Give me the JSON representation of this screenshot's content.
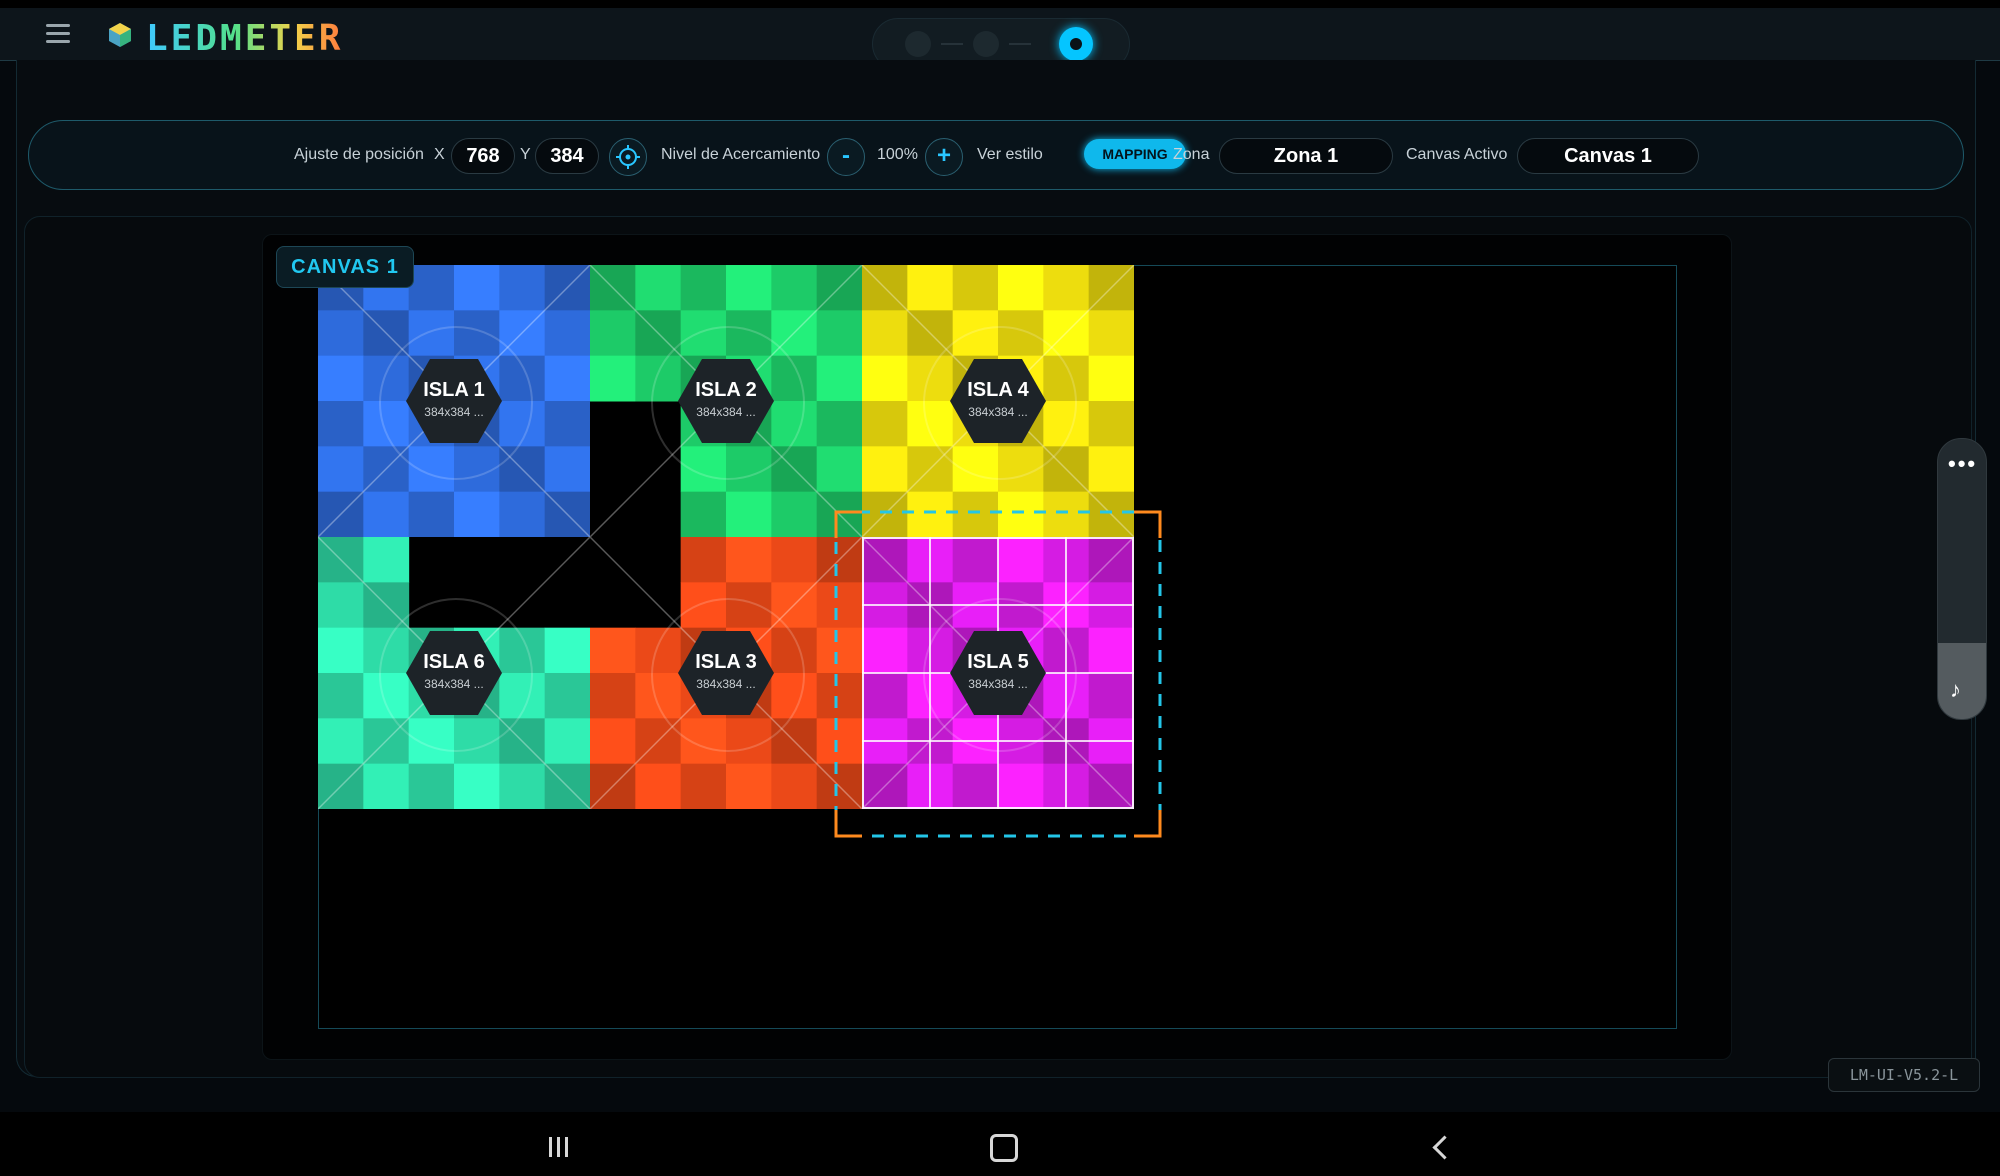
{
  "app": {
    "logo_text": "LEDMETER",
    "version": "LM-UI-V5.2-L"
  },
  "toolbar": {
    "position_label": "Ajuste de posición",
    "x_label": "X",
    "x_value": "768",
    "y_label": "Y",
    "y_value": "384",
    "zoom_label": "Nivel de Acercamiento",
    "zoom_minus": "-",
    "zoom_value": "100%",
    "zoom_plus": "+",
    "style_label": "Ver estilo",
    "style_value": "MAPPING",
    "zone_label": "Zona",
    "zone_value": "Zona 1",
    "canvas_label": "Canvas Activo",
    "canvas_value": "Canvas 1"
  },
  "canvas": {
    "label": "CANVAS 1",
    "islands": [
      {
        "name": "ISLA 1",
        "size": "384x384 ...",
        "color": "#2f6de0"
      },
      {
        "name": "ISLA 2",
        "size": "384x384 ...",
        "color": "#1ecf6a"
      },
      {
        "name": "ISLA 4",
        "size": "384x384 ...",
        "color": "#f2e10e"
      },
      {
        "name": "ISLA 6",
        "size": "384x384 ...",
        "color": "#2fe0aa"
      },
      {
        "name": "ISLA 3",
        "size": "384x384 ...",
        "color": "#f04a18"
      },
      {
        "name": "ISLA 5",
        "size": "384x384 ...",
        "color": "#d91de8"
      }
    ]
  },
  "selection": {
    "dash_color": "#23c6e8",
    "corner_color": "#ff8a1e"
  },
  "sidebar_tool": {
    "more_icon": "more-horizontal-icon",
    "music_icon": "music-note-icon"
  },
  "nav": {
    "recents_icon": "recents-icon",
    "home_icon": "home-icon",
    "back_icon": "back-icon"
  }
}
